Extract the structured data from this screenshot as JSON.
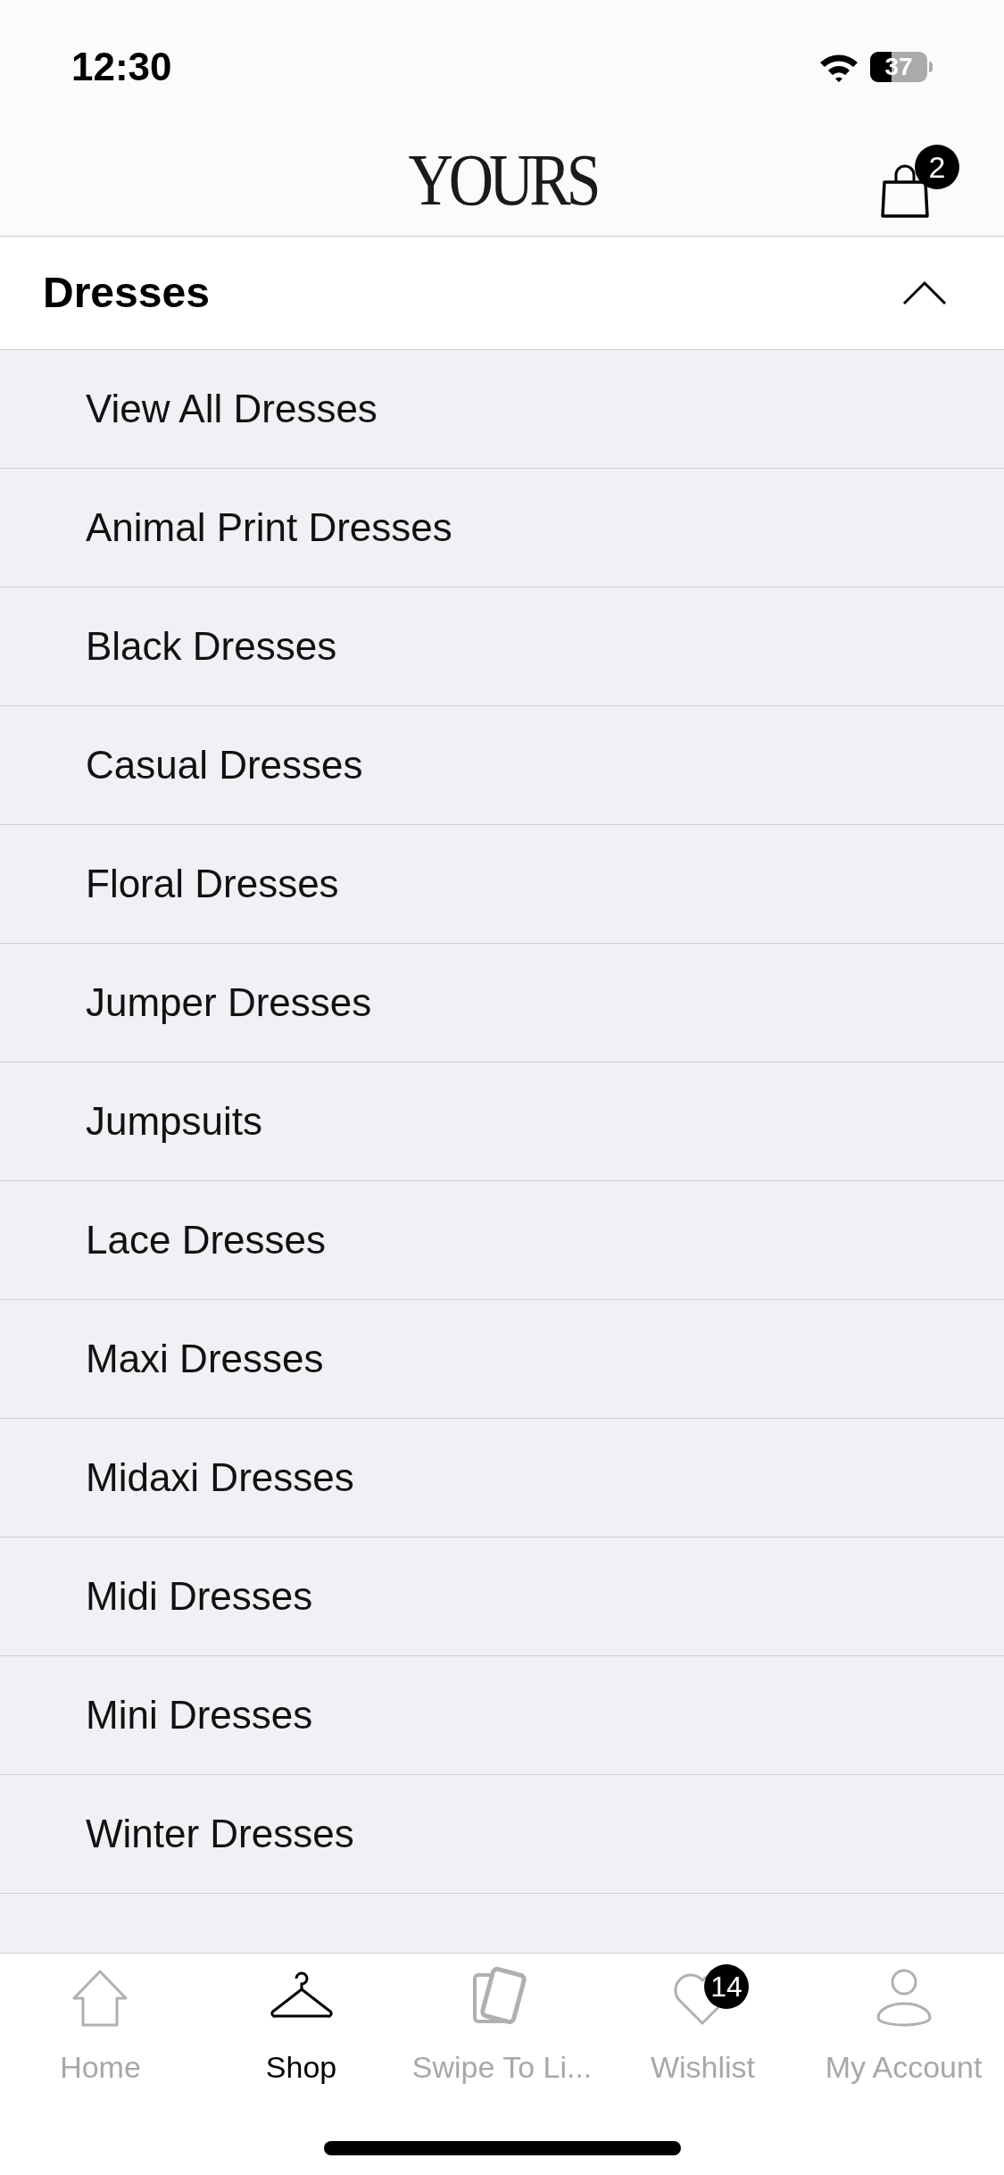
{
  "status_bar": {
    "time": "12:30",
    "battery": "37"
  },
  "header": {
    "logo": "YOURS",
    "cart_count": "2"
  },
  "section": {
    "title": "Dresses",
    "expanded": true
  },
  "items": [
    "View All Dresses",
    "Animal Print Dresses",
    "Black Dresses",
    "Casual Dresses",
    "Floral Dresses",
    "Jumper Dresses",
    "Jumpsuits",
    "Lace Dresses",
    "Maxi Dresses",
    "Midaxi Dresses",
    "Midi Dresses",
    "Mini Dresses",
    "Winter Dresses"
  ],
  "tab_bar": [
    {
      "kind": "home",
      "label": "Home",
      "selected": false
    },
    {
      "kind": "shop",
      "label": "Shop",
      "selected": true
    },
    {
      "kind": "swipe",
      "label": "Swipe To Li...",
      "selected": false
    },
    {
      "kind": "wishlist",
      "label": "Wishlist",
      "selected": false,
      "badge": "14"
    },
    {
      "kind": "account",
      "label": "My Account",
      "selected": false
    }
  ]
}
